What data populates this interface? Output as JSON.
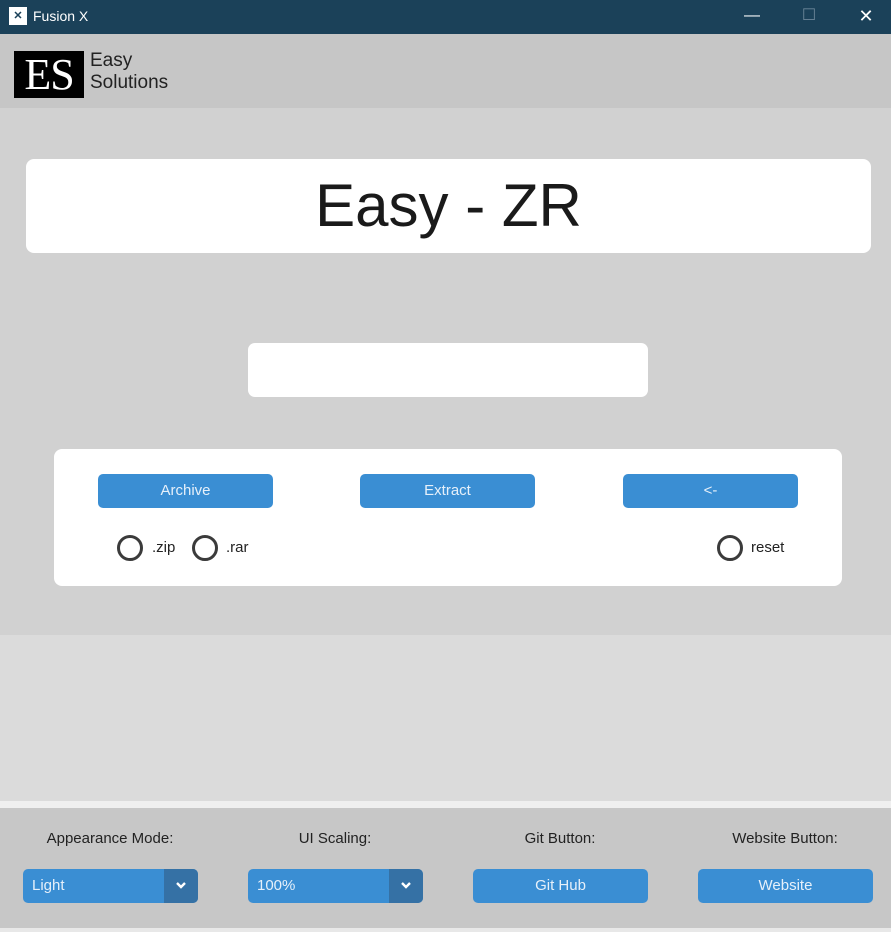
{
  "window": {
    "title": "Fusion X",
    "icon": "x-logo-icon",
    "min_glyph": "—",
    "max_glyph": "☐",
    "close_glyph": "✕"
  },
  "header": {
    "logo_mark": "ES",
    "logo_line1": "Easy",
    "logo_line2": "Solutions"
  },
  "main": {
    "app_title": "Easy - ZR",
    "path_input_value": "",
    "buttons": {
      "archive": "Archive",
      "extract": "Extract",
      "back": "<-"
    },
    "radios": {
      "zip": ".zip",
      "rar": ".rar",
      "reset": "reset"
    }
  },
  "footer": {
    "appearance_label": "Appearance Mode:",
    "appearance_value": "Light",
    "scaling_label": "UI Scaling:",
    "scaling_value": "100%",
    "git_label": "Git Button:",
    "git_button": "Git Hub",
    "website_label": "Website Button:",
    "website_button": "Website"
  },
  "colors": {
    "titlebar": "#1b4159",
    "accent": "#3a8ed3",
    "accent_dark": "#3571a5"
  }
}
